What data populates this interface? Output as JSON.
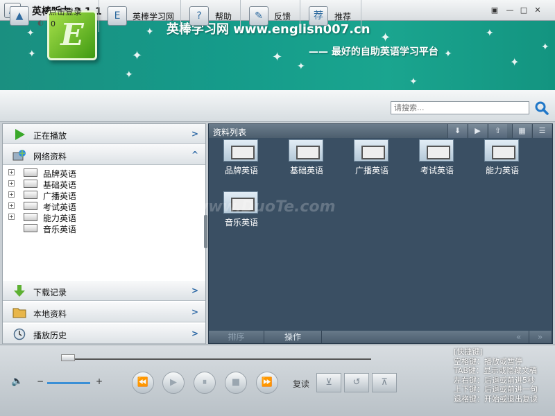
{
  "app": {
    "title": "英棒听力 2.1.1",
    "logo_letter": "E"
  },
  "window_controls": [
    "restore-icon",
    "minimize-icon",
    "maximize-icon",
    "close-icon"
  ],
  "banner": {
    "site": "英棒学习网  www.english007.cn",
    "slogan": "—— 最好的自助英语学习平台",
    "logo_letter": "E"
  },
  "toolbar": {
    "login_label": "点击登录",
    "login_count": "0",
    "site_label": "英棒学习网",
    "help_label": "帮助",
    "feedback_label": "反馈",
    "recommend_label": "推荐",
    "recommend_icon_char": "荐",
    "search_placeholder": "请搜索..."
  },
  "left_panel": {
    "now_playing": "正在播放",
    "online_resources": "网络资料",
    "tree": [
      "品牌英语",
      "基础英语",
      "广播英语",
      "考试英语",
      "能力英语",
      "音乐英语"
    ],
    "downloads": "下载记录",
    "local_resources": "本地资料",
    "play_history": "播放历史"
  },
  "right_panel": {
    "title": "资料列表",
    "tiles": [
      "品牌英语",
      "基础英语",
      "广播英语",
      "考试英语",
      "能力英语",
      "音乐英语"
    ],
    "footer_sort": "排序",
    "footer_action": "操作",
    "footer_prev": "«",
    "footer_next": "»"
  },
  "watermark": "www.DuoTe.com",
  "player": {
    "progress": 0.0,
    "volume": 0.8,
    "repeat_label": "复读"
  },
  "shortcuts": {
    "title": "[快捷键]",
    "lines": [
      "空格键：播放或暂停",
      "TAB键：显示或隐藏文稿",
      "左右键：后退或前进5秒",
      "上下键：后退或前进一句",
      "退格键：开始或退出复读"
    ]
  },
  "colors": {
    "banner_bg": "#159b8a",
    "panel_bg": "#3a4f63",
    "accent_blue": "#2f6aa6"
  }
}
